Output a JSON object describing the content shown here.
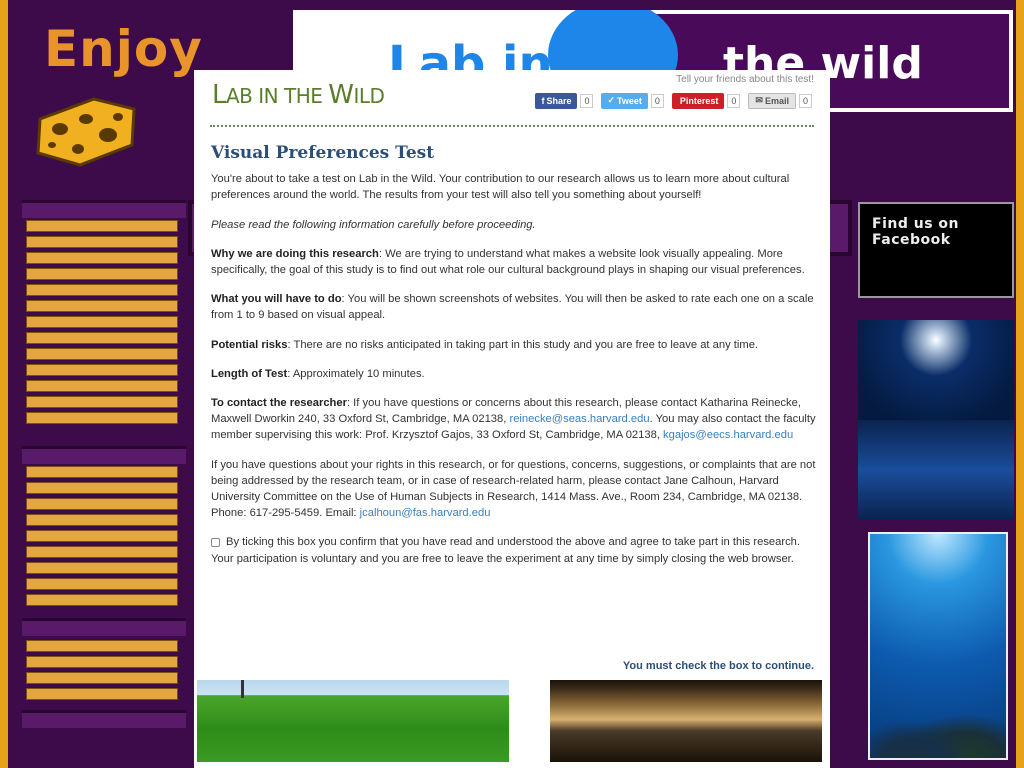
{
  "background": {
    "enjoy_text": "Enjoy",
    "banner_lab": "Lab in",
    "banner_wild": "the wild",
    "facebook_title": "Find us on Facebook"
  },
  "header": {
    "logo_main_1": "L",
    "logo_main_2": "AB IN THE ",
    "logo_main_3": "W",
    "logo_main_4": "ILD",
    "tell_friends": "Tell your friends about this test!",
    "share": [
      {
        "label": "Share",
        "count": "0",
        "color": "#3b5998",
        "icon": "facebook-icon"
      },
      {
        "label": "Tweet",
        "count": "0",
        "color": "#55acee",
        "icon": "twitter-icon"
      },
      {
        "label": "Pinterest",
        "count": "0",
        "color": "#cb2027",
        "icon": "pinterest-icon"
      },
      {
        "label": "Email",
        "count": "0",
        "color": "#d8d8d8",
        "icon": "email-icon"
      }
    ]
  },
  "main": {
    "title": "Visual Preferences Test",
    "intro": "You're about to take a test on Lab in the Wild. Your contribution to our research allows us to learn more about cultural preferences around the world. The results from your test will also tell you something about yourself!",
    "please_read": "Please read the following information carefully before proceeding.",
    "why_label": "Why we are doing this research",
    "why_text": ": We are trying to understand what makes a website look visually appealing. More specifically, the goal of this study is to find out what role our cultural background plays in shaping our visual preferences.",
    "what_label": "What you will have to do",
    "what_text": ": You will be shown screenshots of websites. You will then be asked to rate each one on a scale from 1 to 9 based on visual appeal.",
    "risks_label": "Potential risks",
    "risks_text": ": There are no risks anticipated in taking part in this study and you are free to leave at any time.",
    "length_label": "Length of Test",
    "length_text": ": Approximately 10 minutes.",
    "contact_label": "To contact the researcher",
    "contact_text_1": ": If you have questions or concerns about this research, please contact Katharina Reinecke, Maxwell Dworkin 240, 33 Oxford St, Cambridge, MA 02138, ",
    "contact_email_1": "reinecke@seas.harvard.edu",
    "contact_text_2": ". You may also contact the faculty member supervising this work: Prof. Krzysztof Gajos, 33 Oxford St, Cambridge, MA 02138, ",
    "contact_email_2": "kgajos@eecs.harvard.edu",
    "rights_text": "If you have questions about your rights in this research, or for questions, concerns, suggestions, or complaints that are not being addressed by the research team, or in case of research-related harm, please contact Jane Calhoun, Harvard University Committee on the Use of Human Subjects in Research, 1414 Mass. Ave., Room 234, Cambridge, MA 02138. Phone: 617-295-5459. Email: ",
    "rights_email": "jcalhoun@fas.harvard.edu",
    "consent_text": "By ticking this box you confirm that you have read and understood the above and agree to take part in this research. Your participation is voluntary and you are free to leave the experiment at any time by simply closing the web browser.",
    "must_check": "You must check the box to continue."
  }
}
